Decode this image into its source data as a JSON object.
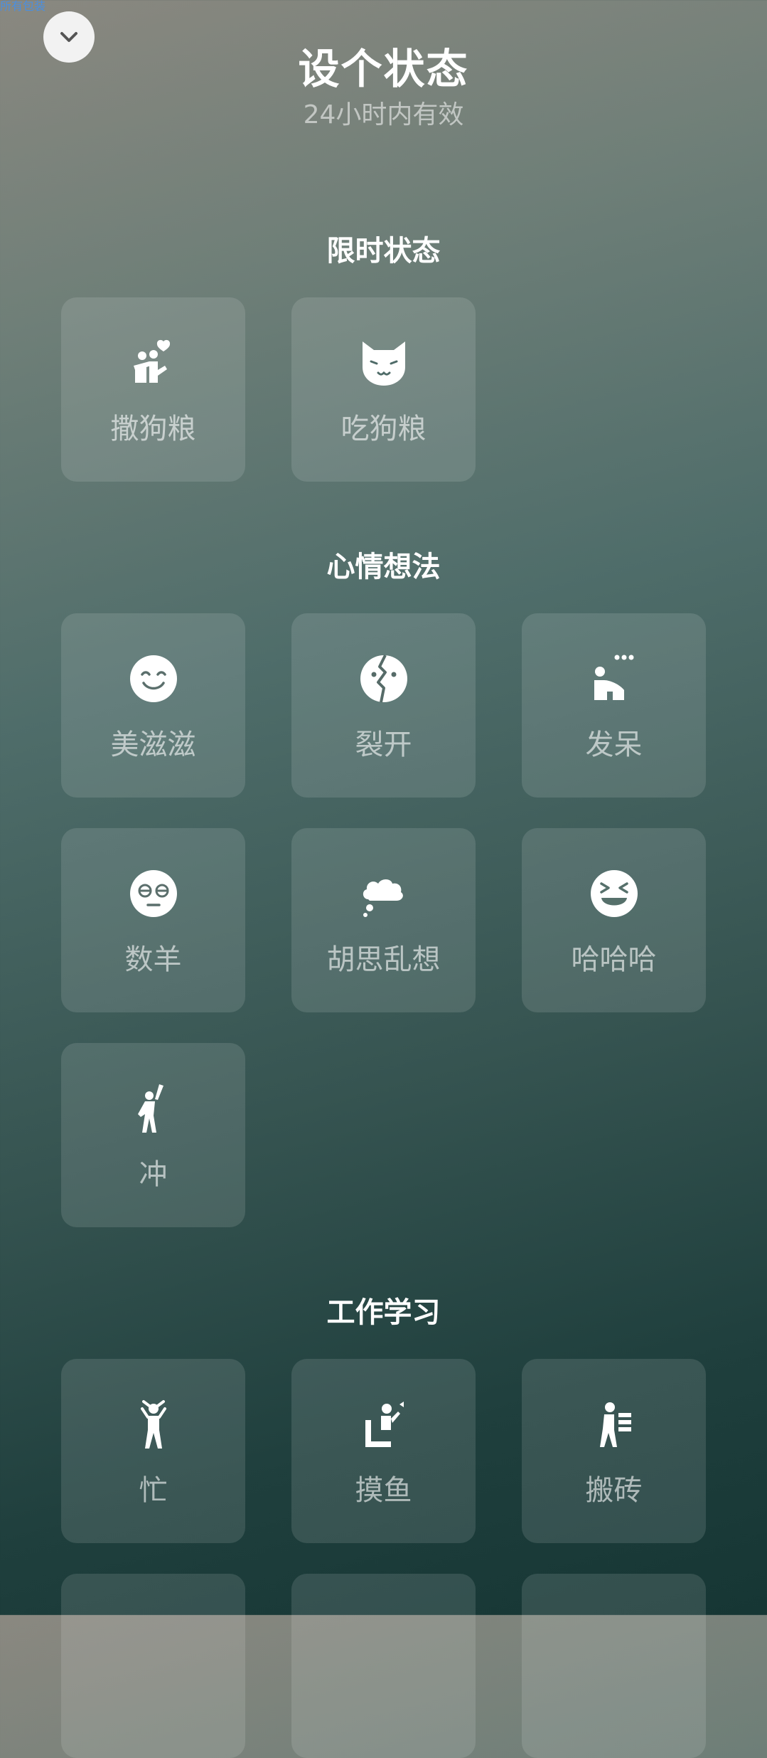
{
  "status_bar": {
    "tiny_text": "所有包装"
  },
  "header": {
    "title": "设个状态",
    "subtitle": "24小时内有效"
  },
  "sections": {
    "limited": {
      "title": "限时状态",
      "items": [
        {
          "label": "撒狗粮",
          "icon": "couple-heart-icon"
        },
        {
          "label": "吃狗粮",
          "icon": "cat-face-icon"
        }
      ]
    },
    "mood": {
      "title": "心情想法",
      "items": [
        {
          "label": "美滋滋",
          "icon": "smile-face-icon"
        },
        {
          "label": "裂开",
          "icon": "cracked-face-icon"
        },
        {
          "label": "发呆",
          "icon": "daze-person-icon"
        },
        {
          "label": "数羊",
          "icon": "sleepy-face-icon"
        },
        {
          "label": "胡思乱想",
          "icon": "thought-cloud-icon"
        },
        {
          "label": "哈哈哈",
          "icon": "laughing-face-icon"
        },
        {
          "label": "冲",
          "icon": "cheer-person-icon"
        }
      ]
    },
    "work": {
      "title": "工作学习",
      "items": [
        {
          "label": "忙",
          "icon": "busy-person-icon"
        },
        {
          "label": "摸鱼",
          "icon": "slacking-person-icon"
        },
        {
          "label": "搬砖",
          "icon": "carry-bricks-icon"
        }
      ]
    }
  }
}
